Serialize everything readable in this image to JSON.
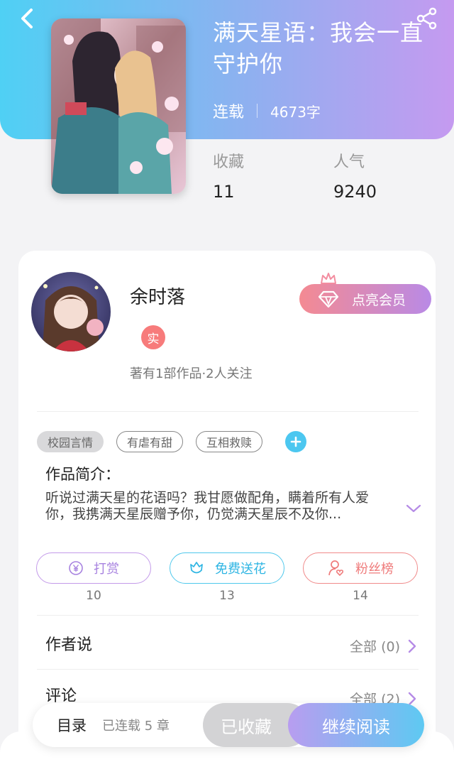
{
  "book": {
    "title": "满天星语：我会一直守护你",
    "status": "连载",
    "word_count": "4673字",
    "favorites_label": "收藏",
    "favorites_value": "11",
    "popularity_label": "人气",
    "popularity_value": "9240"
  },
  "author": {
    "name": "余时落",
    "verified_badge": "实",
    "meta": "著有1部作品·2人关注",
    "vip_button": "点亮会员"
  },
  "tags": [
    {
      "label": "校园言情",
      "style": "filled"
    },
    {
      "label": "有虐有甜",
      "style": "outline"
    },
    {
      "label": "互相救赎",
      "style": "outline"
    }
  ],
  "intro": {
    "title": "作品简介：",
    "text": "听说过满天星的花语吗？我甘愿做配角，瞒着所有人爱你，我携满天星辰赠予你，仍觉满天星辰不及你..."
  },
  "actions": [
    {
      "label": "打赏",
      "count": "10",
      "icon": "yen-coin-icon"
    },
    {
      "label": "免费送花",
      "count": "13",
      "icon": "flower-icon"
    },
    {
      "label": "粉丝榜",
      "count": "14",
      "icon": "user-heart-icon"
    }
  ],
  "rows": {
    "author_says_label": "作者说",
    "author_says_right": "全部 (0)",
    "comments_label": "评论",
    "comments_right": "全部 (2)"
  },
  "bottom_bar": {
    "toc_label": "目录",
    "toc_sub": "已连载 5 章",
    "favorited_button": "已收藏",
    "read_button": "继续阅读"
  },
  "colors": {
    "header_gradient_start": "#4fd0f4",
    "header_gradient_end": "#c59af0",
    "accent_purple": "#a883e0",
    "accent_blue": "#2eb5e3",
    "accent_red": "#ef7b7b"
  }
}
